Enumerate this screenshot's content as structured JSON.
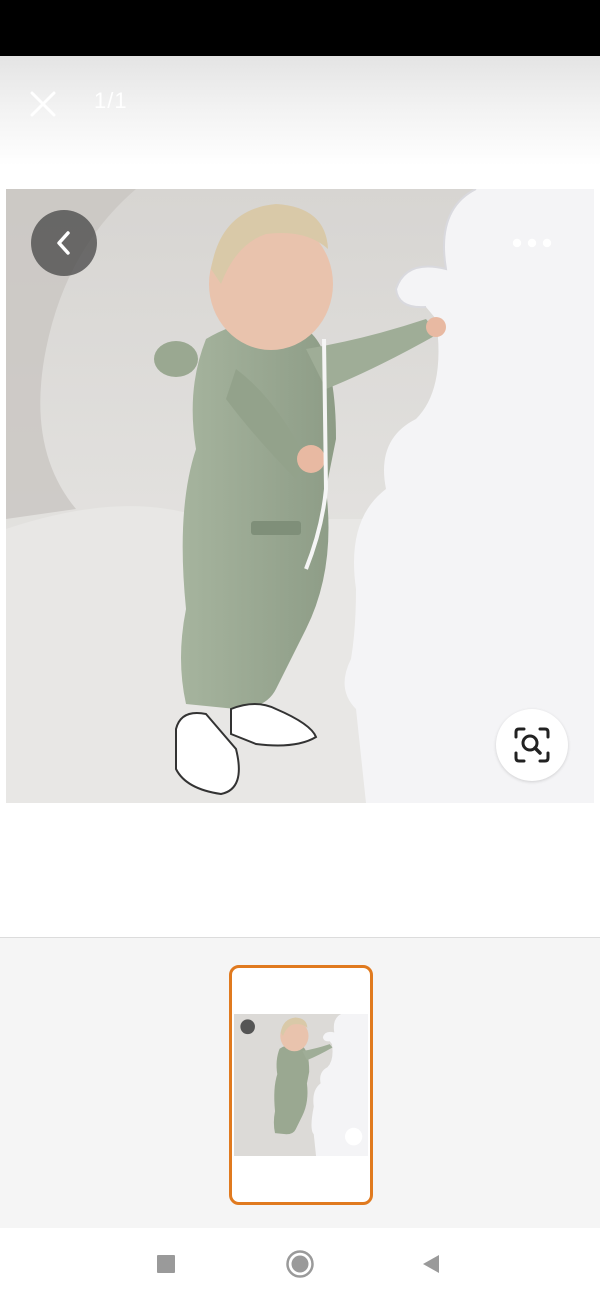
{
  "viewer": {
    "page_counter": "1/1",
    "close_icon": "close-icon",
    "back_icon": "chevron-left-icon",
    "more_icon": "more-horizontal-icon",
    "lens_icon": "visual-search-icon"
  },
  "thumbnails": {
    "selected_index": 0,
    "accent_color": "#e07a1f"
  },
  "system_nav": {
    "recents_icon": "square-icon",
    "home_icon": "circle-icon",
    "back_icon": "triangle-back-icon"
  }
}
